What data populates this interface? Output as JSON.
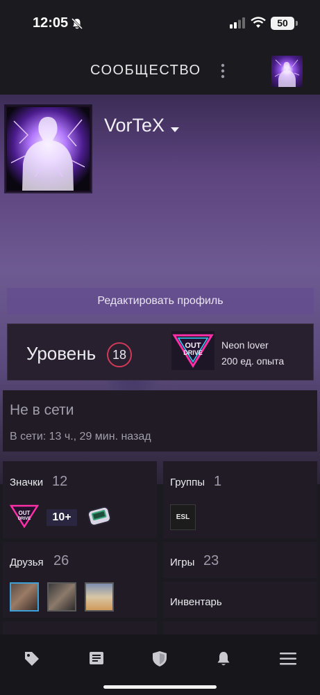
{
  "status_bar": {
    "time": "12:05",
    "battery": "50",
    "icons": [
      "bell-off-icon",
      "signal-icon",
      "wifi-icon",
      "battery-icon"
    ]
  },
  "header": {
    "title": "СООБЩЕСТВО",
    "menu_icon": "kebab-menu-icon"
  },
  "profile": {
    "persona_name": "VorTeX",
    "edit_button": "Редактировать профиль",
    "level_label": "Уровень",
    "level_value": "18",
    "featured_badge": {
      "title": "Neon lover",
      "xp": "200 ед. опыта"
    },
    "status": {
      "title": "Не в сети",
      "last_online": "В сети: 13 ч., 29 мин. назад"
    }
  },
  "sections": {
    "badges": {
      "label": "Значки",
      "count": "12",
      "extra_badge": "10+"
    },
    "groups": {
      "label": "Группы",
      "count": "1",
      "group_tag": "ESL"
    },
    "friends": {
      "label": "Друзья",
      "count": "26"
    },
    "games": {
      "label": "Игры",
      "count": "23"
    },
    "inventory": {
      "label": "Инвентарь"
    }
  },
  "nav": {
    "items": [
      "tag-icon",
      "news-icon",
      "shield-icon",
      "bell-icon",
      "menu-icon"
    ]
  },
  "colors": {
    "accent": "#d03a58",
    "card_bg": "#201b25",
    "profile_bg": "#6e5a92"
  }
}
